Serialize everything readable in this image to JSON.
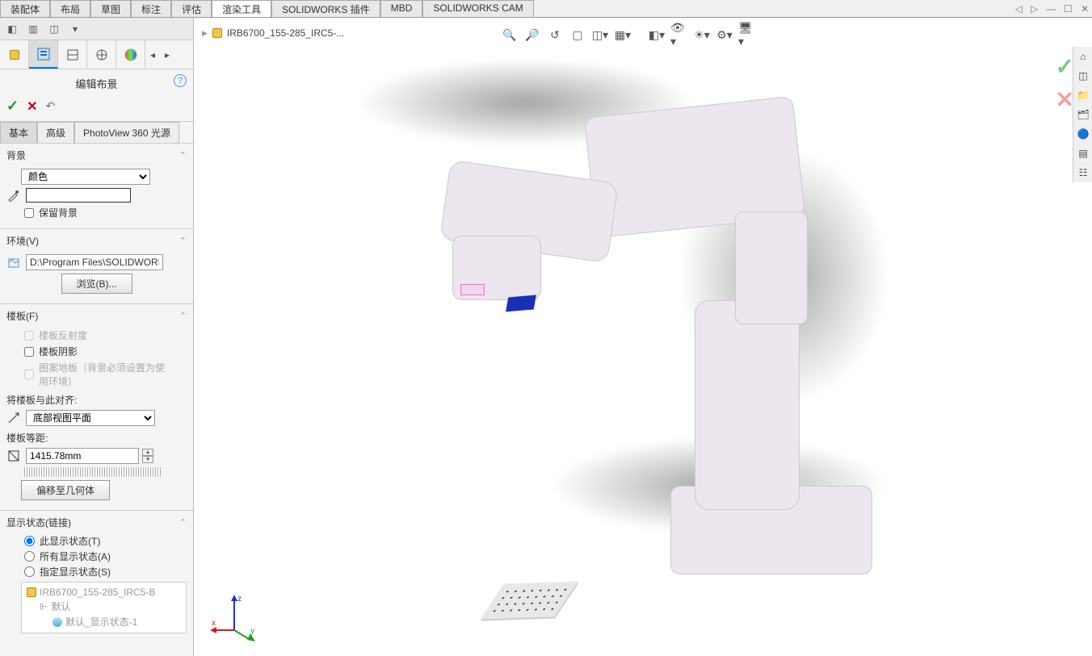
{
  "ribbon": {
    "tabs": [
      "装配体",
      "布局",
      "草图",
      "标注",
      "评估",
      "渲染工具",
      "SOLIDWORKS 插件",
      "MBD",
      "SOLIDWORKS CAM"
    ],
    "active_index": 5
  },
  "panel": {
    "title": "编辑布景",
    "sub_tabs": [
      "基本",
      "高级",
      "PhotoView 360 光源"
    ],
    "sub_tab_active": 0,
    "background": {
      "section_label": "背景",
      "type_selected": "颜色",
      "keep_bg_label": "保留背景",
      "keep_bg_checked": false
    },
    "environment": {
      "section_label": "环境(V)",
      "path": "D:\\Program Files\\SOLIDWORKS",
      "browse_label": "浏览(B)..."
    },
    "floor": {
      "section_label": "楼板(F)",
      "reflect_label": "楼板反射度",
      "reflect_checked": false,
      "reflect_disabled": true,
      "shadow_label": "楼板阴影",
      "shadow_checked": false,
      "pattern_label": "图案地板（背景必须设置为使用环境）",
      "pattern_disabled": true,
      "align_label": "将楼板与此对齐:",
      "align_selected": "底部视图平面",
      "distance_label": "楼板等距:",
      "distance_value": "1415.78mm",
      "offset_button": "偏移至几何体"
    },
    "display_state": {
      "section_label": "显示状态(链接)",
      "opt_this": "此显示状态(T)",
      "opt_all": "所有显示状态(A)",
      "opt_spec": "指定显示状态(S)",
      "selected_index": 0,
      "tree_root": "IRB6700_155-285_IRC5-B",
      "tree_default": "默认",
      "tree_state": "默认_显示状态-1"
    }
  },
  "breadcrumb": {
    "doc_name": "IRB6700_155-285_IRC5-..."
  },
  "icons": {
    "help": "?",
    "check": "✓",
    "cross": "✕",
    "undo": "↶",
    "chevron": "⌃",
    "triangle": "▶",
    "dropdown": "▾"
  },
  "triad": {
    "x_label": "x",
    "y_label": "y",
    "z_label": "z"
  }
}
